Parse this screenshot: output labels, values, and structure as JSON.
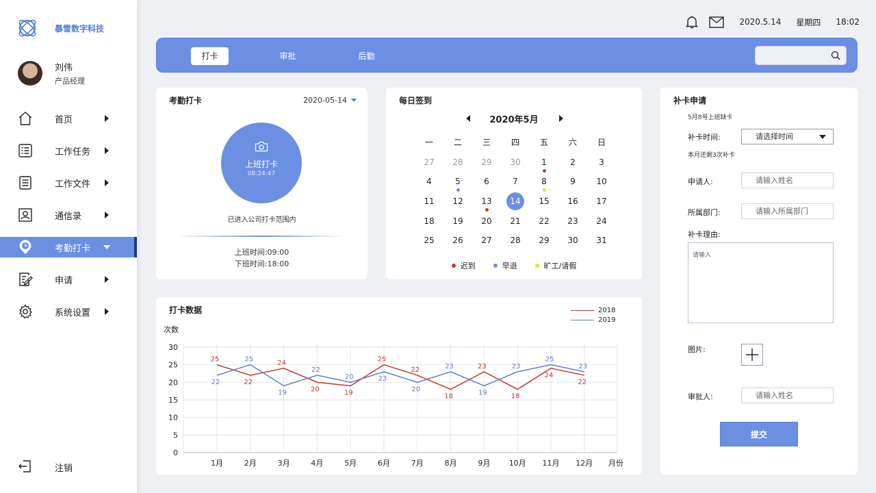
{
  "brand": {
    "name": "暴雪数字科技"
  },
  "user": {
    "name": "刘伟",
    "role": "产品经理"
  },
  "menu": [
    {
      "label": "首页",
      "icon": "home-icon"
    },
    {
      "label": "工作任务",
      "icon": "task-list-icon"
    },
    {
      "label": "工作文件",
      "icon": "document-icon"
    },
    {
      "label": "通信录",
      "icon": "contacts-icon"
    },
    {
      "label": "考勤打卡",
      "icon": "clock-pin-icon",
      "active": true
    },
    {
      "label": "申请",
      "icon": "edit-form-icon"
    },
    {
      "label": "系统设置",
      "icon": "gear-icon"
    }
  ],
  "logout": {
    "label": "注销"
  },
  "topbar": {
    "date": "2020.5.14",
    "weekday": "星期四",
    "time": "18:02"
  },
  "tabs": [
    {
      "label": "打卡",
      "active": true
    },
    {
      "label": "审批"
    },
    {
      "label": "后勤"
    }
  ],
  "search": {
    "placeholder": ""
  },
  "attendance": {
    "title": "考勤打卡",
    "date": "2020-05-14",
    "punch_label": "上班打卡",
    "punch_time": "08:24:47",
    "range_note": "已进入公司打卡范围内",
    "start_time": "上班时间:09:00",
    "end_time": "下班时间:18:00"
  },
  "calendar": {
    "title": "每日签到",
    "month_label": "2020年5月",
    "weekdays": [
      "一",
      "二",
      "三",
      "四",
      "五",
      "六",
      "日"
    ],
    "weeks": [
      [
        {
          "d": "27",
          "m": true
        },
        {
          "d": "28",
          "m": true
        },
        {
          "d": "29",
          "m": true
        },
        {
          "d": "30",
          "m": true
        },
        {
          "d": "1",
          "dot": "late"
        },
        {
          "d": "2"
        },
        {
          "d": "3"
        }
      ],
      [
        {
          "d": "4"
        },
        {
          "d": "5",
          "dot": "early"
        },
        {
          "d": "6"
        },
        {
          "d": "7"
        },
        {
          "d": "8",
          "dot": "absent"
        },
        {
          "d": "9"
        },
        {
          "d": "10"
        }
      ],
      [
        {
          "d": "11"
        },
        {
          "d": "12"
        },
        {
          "d": "13",
          "dot": "late"
        },
        {
          "d": "14",
          "today": true
        },
        {
          "d": "15"
        },
        {
          "d": "16"
        },
        {
          "d": "17"
        }
      ],
      [
        {
          "d": "18"
        },
        {
          "d": "19"
        },
        {
          "d": "20"
        },
        {
          "d": "21"
        },
        {
          "d": "22"
        },
        {
          "d": "23"
        },
        {
          "d": "24"
        }
      ],
      [
        {
          "d": "25"
        },
        {
          "d": "26"
        },
        {
          "d": "27"
        },
        {
          "d": "28"
        },
        {
          "d": "29"
        },
        {
          "d": "30"
        },
        {
          "d": "31"
        }
      ]
    ],
    "legend": [
      {
        "key": "late",
        "label": "迟到",
        "color": "#c0392b"
      },
      {
        "key": "early",
        "label": "早退",
        "color": "#6b8fe3"
      },
      {
        "key": "absent",
        "label": "旷工/请假",
        "color": "#e6e03a"
      }
    ]
  },
  "makeup": {
    "title": "补卡申请",
    "missing_note": "5月8号上班缺卡",
    "time_label": "补卡时间:",
    "time_value": "请选择时间",
    "remaining_note": "本月还剩3次补卡",
    "applicant_label": "申请人:",
    "applicant_placeholder": "请输入姓名",
    "dept_label": "所属部门:",
    "dept_placeholder": "请输入所属部门",
    "reason_label": "补卡理由:",
    "reason_placeholder": "请输入",
    "image_label": "图片:",
    "approver_label": "审批人:",
    "approver_placeholder": "请输入姓名",
    "submit_label": "提交"
  },
  "chart_title": "打卡数据",
  "colors": {
    "accent": "#6b8fe3",
    "series_2018": "#c0392b",
    "series_2019": "#5b7fc7"
  },
  "chart_data": {
    "type": "line",
    "ylabel": "次数",
    "xlabel": "月份",
    "categories": [
      "1月",
      "2月",
      "3月",
      "4月",
      "5月",
      "6月",
      "7月",
      "8月",
      "9月",
      "10月",
      "11月",
      "12月"
    ],
    "ylim": [
      0,
      30
    ],
    "yticks": [
      0,
      5,
      10,
      15,
      20,
      25,
      30
    ],
    "grid": true,
    "legend_position": "top-right",
    "series": [
      {
        "name": "2018",
        "values": [
          25,
          22,
          24,
          20,
          19,
          25,
          22,
          18,
          23,
          18,
          24,
          22
        ]
      },
      {
        "name": "2019",
        "values": [
          22,
          25,
          19,
          22,
          20,
          23,
          20,
          23,
          19,
          23,
          25,
          23
        ]
      }
    ]
  }
}
